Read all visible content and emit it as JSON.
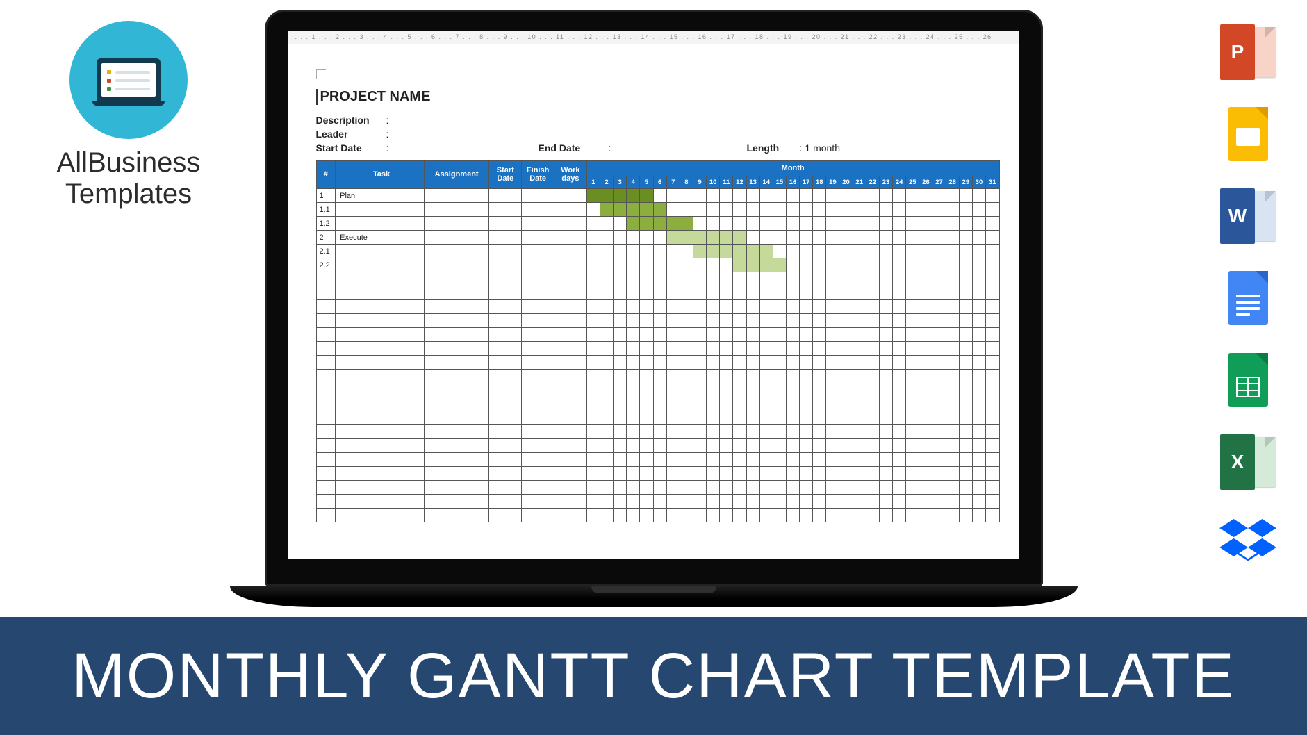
{
  "brand": {
    "line1": "AllBusiness",
    "line2": "Templates"
  },
  "banner": "MONTHLY GANTT CHART TEMPLATE",
  "apps": {
    "powerpoint": "P",
    "word": "W",
    "excel": "X"
  },
  "ruler": ". . . 1 . . . 2 . . . 3 . . . 4 . . . 5 . . . 6 . . . 7 . . . 8 . . . 9 . . . 10 . . . 11 . . . 12 . . . 13 . . . 14 . . . 15 . . . 16 . . . 17 . . . 18 . . . 19 . . . 20 . . . 21 . . . 22 . . . 23 . . . 24 . . . 25 . . . 26",
  "doc": {
    "title": "PROJECT NAME",
    "meta": {
      "description_label": "Description",
      "leader_label": "Leader",
      "start_label": "Start Date",
      "end_label": "End Date",
      "length_label": "Length",
      "length_value": "1 month",
      "colon": ":"
    },
    "headers": {
      "num": "#",
      "task": "Task",
      "assignment": "Assignment",
      "start": "Start Date",
      "finish": "Finish Date",
      "work": "Work days",
      "month": "Month"
    },
    "rows": [
      {
        "num": "1",
        "task": "Plan"
      },
      {
        "num": "1.1",
        "task": ""
      },
      {
        "num": "1.2",
        "task": ""
      },
      {
        "num": "2",
        "task": "Execute"
      },
      {
        "num": "2.1",
        "task": ""
      },
      {
        "num": "2.2",
        "task": ""
      }
    ]
  },
  "chart_data": {
    "type": "gantt",
    "title": "PROJECT NAME",
    "xlabel": "Month",
    "x_range": [
      1,
      31
    ],
    "tasks": [
      {
        "id": "1",
        "name": "Plan",
        "start": 1,
        "end": 5,
        "color": "#6b8e23"
      },
      {
        "id": "1.1",
        "name": "",
        "start": 2,
        "end": 6,
        "color": "#8cae3e"
      },
      {
        "id": "1.2",
        "name": "",
        "start": 4,
        "end": 8,
        "color": "#8cae3e"
      },
      {
        "id": "2",
        "name": "Execute",
        "start": 7,
        "end": 12,
        "color": "#c4d99a"
      },
      {
        "id": "2.1",
        "name": "",
        "start": 9,
        "end": 14,
        "color": "#c4d99a"
      },
      {
        "id": "2.2",
        "name": "",
        "start": 12,
        "end": 15,
        "color": "#c4d99a"
      }
    ]
  }
}
